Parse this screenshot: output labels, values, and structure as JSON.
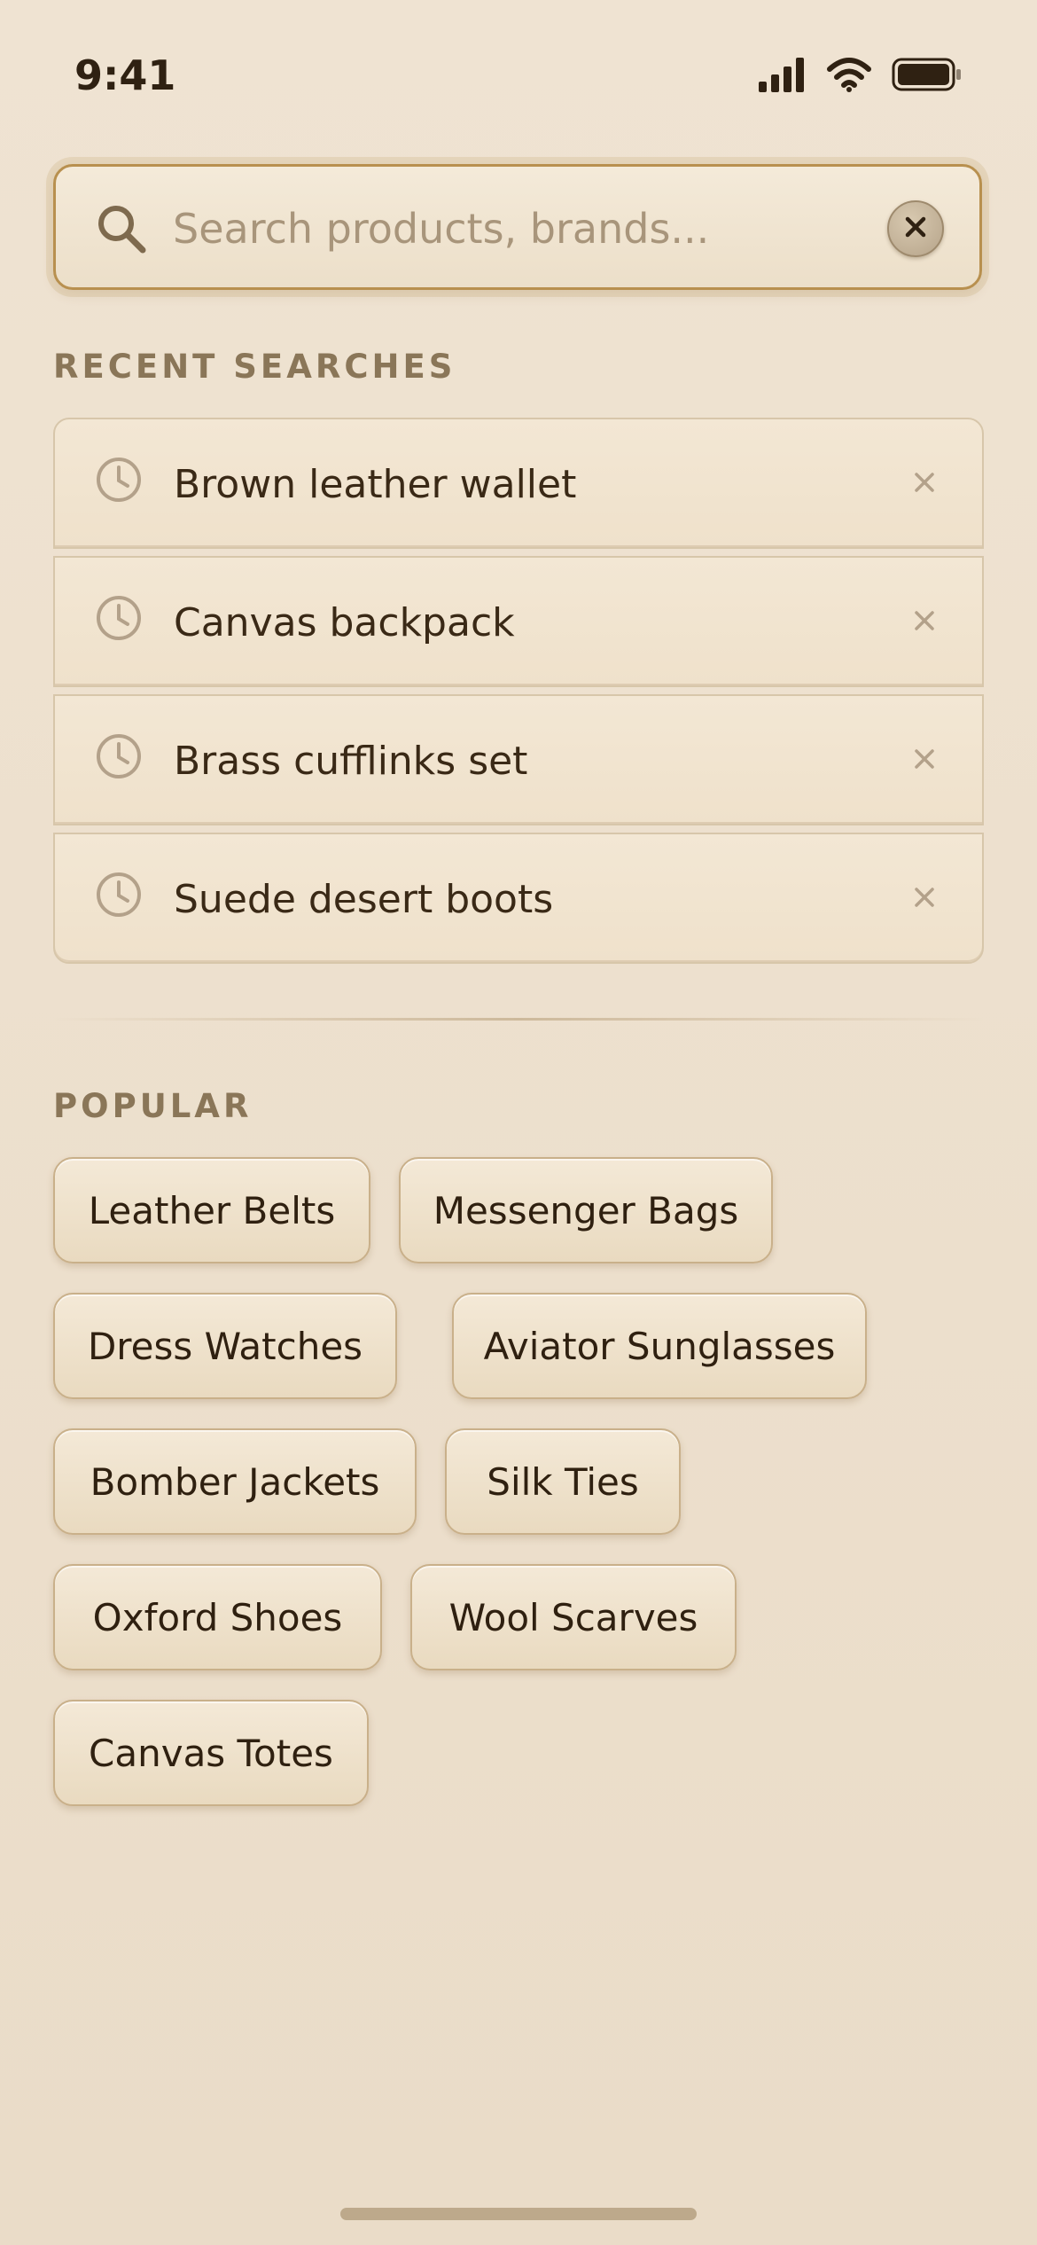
{
  "status_bar": {
    "time": "9:41",
    "icons": [
      "signal-icon",
      "wifi-icon",
      "battery-icon"
    ]
  },
  "search": {
    "placeholder": "Search products, brands...",
    "value": "",
    "search_icon": "search-icon",
    "clear_icon": "close-icon"
  },
  "recent": {
    "heading": "RECENT SEARCHES",
    "items": [
      {
        "label": "Brown leather wallet",
        "icon": "clock-icon"
      },
      {
        "label": "Canvas backpack",
        "icon": "clock-icon"
      },
      {
        "label": "Brass cufflinks set",
        "icon": "clock-icon"
      },
      {
        "label": "Suede desert boots",
        "icon": "clock-icon"
      }
    ]
  },
  "popular": {
    "heading": "POPULAR",
    "chips": [
      "Leather Belts",
      "Messenger Bags",
      "Dress Watches",
      "Aviator Sunglasses",
      "Bomber Jackets",
      "Silk Ties",
      "Oxford Shoes",
      "Wool Scarves",
      "Canvas Totes"
    ]
  },
  "colors": {
    "background": "#efe3d2",
    "accent_border": "#b8904f",
    "text_primary": "#3b2a18",
    "text_muted": "#8a7658",
    "placeholder": "#a8957b"
  }
}
